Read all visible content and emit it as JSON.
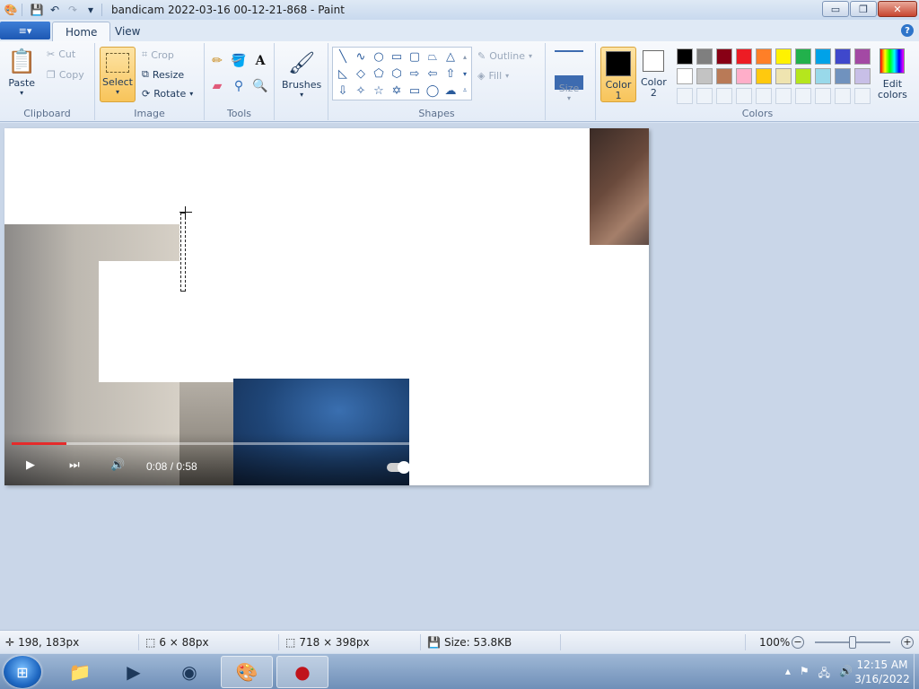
{
  "window": {
    "title": "bandicam 2022-03-16 00-12-21-868 - Paint",
    "minimize": "▭",
    "maximize": "❐",
    "close": "✕"
  },
  "tabs": {
    "file_glyph": "≡▾",
    "home": "Home",
    "view": "View",
    "help": "?"
  },
  "clipboard": {
    "label": "Clipboard",
    "paste": "Paste",
    "cut": "Cut",
    "copy": "Copy"
  },
  "image": {
    "label": "Image",
    "select": "Select",
    "crop": "Crop",
    "resize": "Resize",
    "rotate": "Rotate"
  },
  "tools": {
    "label": "Tools"
  },
  "brushes": {
    "label": "Brushes"
  },
  "shapes": {
    "label": "Shapes",
    "outline": "Outline",
    "fill": "Fill"
  },
  "size": {
    "label": "Size"
  },
  "colors": {
    "label": "Colors",
    "color1_line1": "Color",
    "color1_line2": "1",
    "color2_line1": "Color",
    "color2_line2": "2",
    "edit_line1": "Edit",
    "edit_line2": "colors",
    "color1": "#000000",
    "color2": "#ffffff",
    "palette_row1": [
      "#000000",
      "#7f7f7f",
      "#880015",
      "#ed1c24",
      "#ff7f27",
      "#fff200",
      "#22b14c",
      "#00a2e8",
      "#3f48cc",
      "#a349a4"
    ],
    "palette_row2": [
      "#ffffff",
      "#c3c3c3",
      "#b97a57",
      "#ffaec9",
      "#ffc90e",
      "#efe4b0",
      "#b5e61d",
      "#99d9ea",
      "#7092be",
      "#c8bfe7"
    ]
  },
  "video": {
    "time": "0:08 / 0:58",
    "progress": 0.138
  },
  "status": {
    "cursor": "198, 183px",
    "selection": "6 × 88px",
    "canvas_size": "718 × 398px",
    "file_size": "Size: 53.8KB",
    "zoom": "100%"
  },
  "taskbar": {
    "time": "12:15 AM",
    "date": "3/16/2022"
  }
}
